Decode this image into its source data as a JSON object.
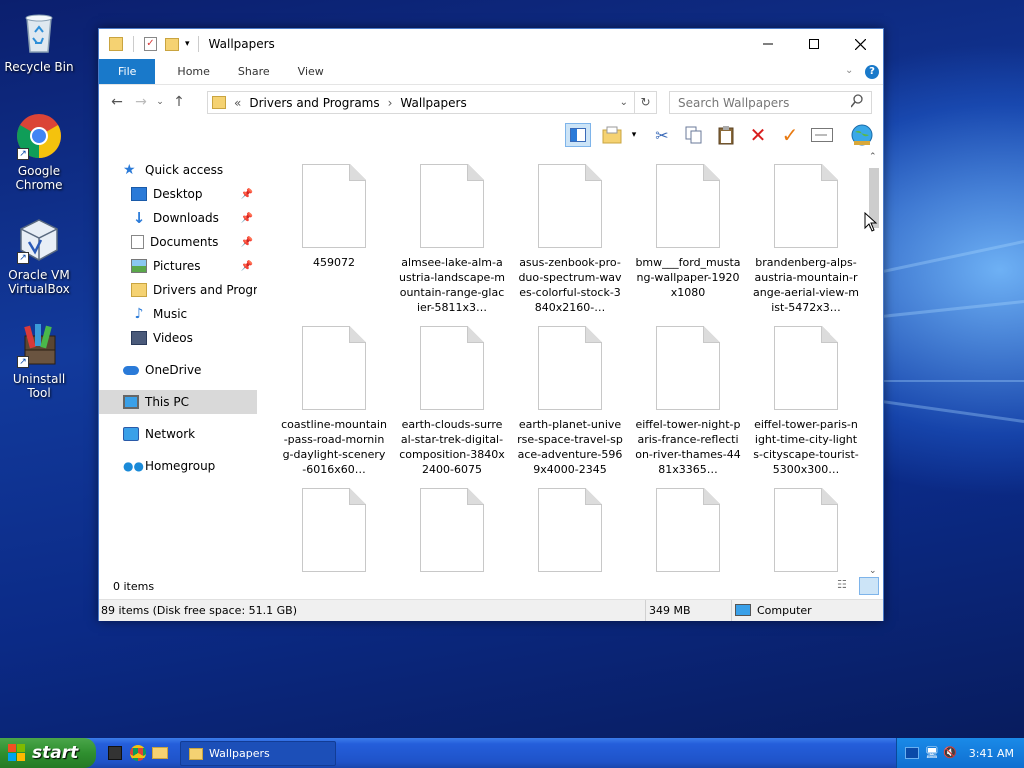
{
  "desktop": {
    "icons": [
      {
        "label": "Recycle Bin",
        "icon": "recycle-bin-icon"
      },
      {
        "label": "Google Chrome",
        "icon": "chrome-icon"
      },
      {
        "label": "Oracle VM VirtualBox",
        "icon": "virtualbox-icon"
      },
      {
        "label": "Uninstall Tool",
        "icon": "uninstall-tool-icon"
      }
    ]
  },
  "window": {
    "title": "Wallpapers",
    "ribbon_tabs": [
      "File",
      "Home",
      "Share",
      "View"
    ],
    "address": {
      "overflow": "«",
      "crumbs": [
        "Drivers and Programs",
        "Wallpapers"
      ],
      "separator": "›"
    },
    "search_placeholder": "Search Wallpapers",
    "nav": {
      "quick_access": "Quick access",
      "items": [
        {
          "label": "Desktop",
          "pinned": true
        },
        {
          "label": "Downloads",
          "pinned": true
        },
        {
          "label": "Documents",
          "pinned": true
        },
        {
          "label": "Pictures",
          "pinned": true
        },
        {
          "label": "Drivers and Programs",
          "pinned": false
        },
        {
          "label": "Music",
          "pinned": false
        },
        {
          "label": "Videos",
          "pinned": false
        }
      ],
      "onedrive": "OneDrive",
      "this_pc": "This PC",
      "network": "Network",
      "homegroup": "Homegroup"
    },
    "files": [
      "459072",
      "almsee-lake-alm-austria-landscape-mountain-range-glacier-5811x3…",
      "asus-zenbook-pro-duo-spectrum-waves-colorful-stock-3840x2160-…",
      "bmw___ford_mustang-wallpaper-1920x1080",
      "brandenberg-alps-austria-mountain-range-aerial-view-mist-5472x3…",
      "coastline-mountain-pass-road-morning-daylight-scenery-6016x60…",
      "earth-clouds-surreal-star-trek-digital-composition-3840x2400-6075",
      "earth-planet-universe-space-travel-space-adventure-5969x4000-2345",
      "eiffel-tower-night-paris-france-reflection-river-thames-4481x3365…",
      "eiffel-tower-paris-night-time-city-lights-cityscape-tourist-5300x300…",
      "",
      "",
      "",
      "",
      ""
    ],
    "selection_status": "0 items",
    "status": {
      "items": "89 items (Disk free space: 51.1 GB)",
      "size": "349 MB",
      "location": "Computer"
    }
  },
  "taskbar": {
    "start_label": "start",
    "task_item": "Wallpapers",
    "clock": "3:41 AM"
  }
}
